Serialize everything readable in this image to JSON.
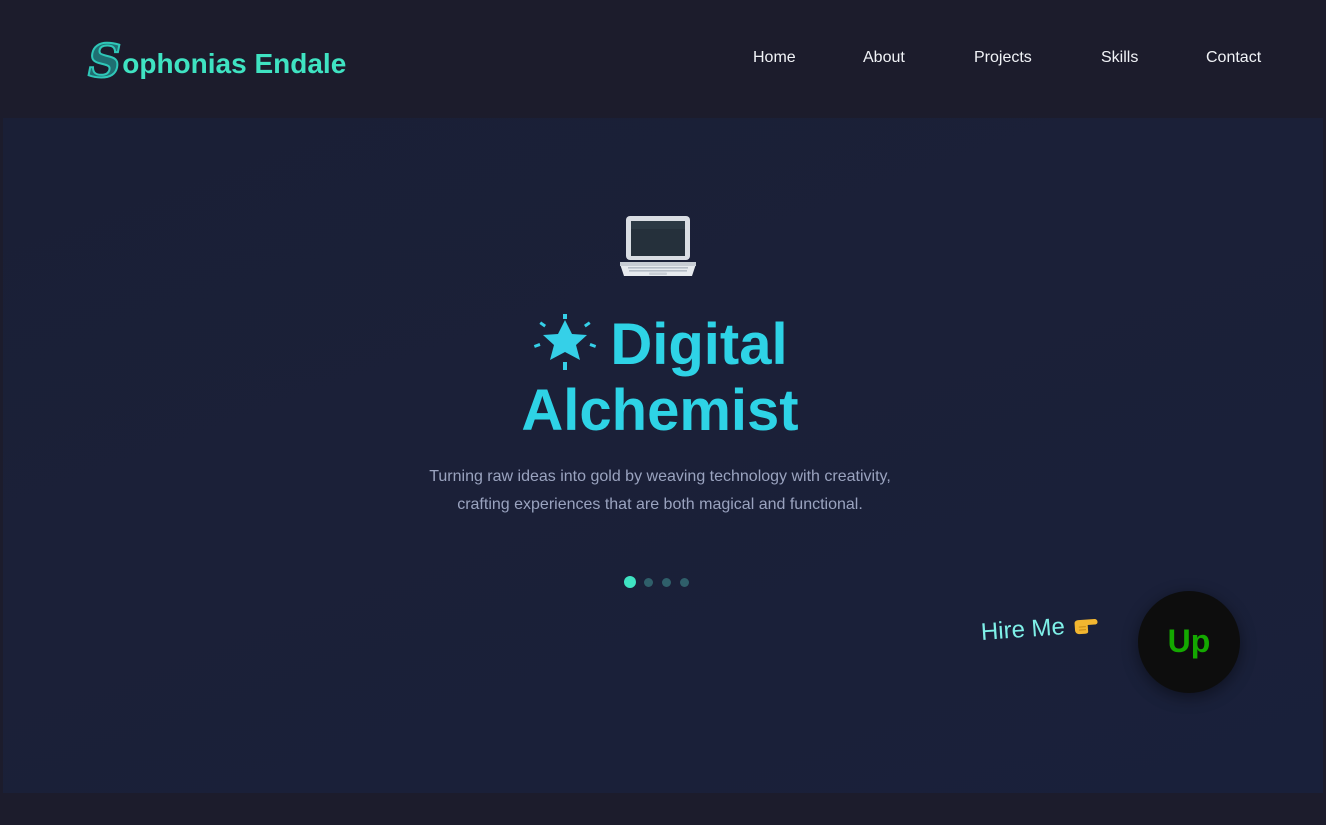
{
  "header": {
    "logo_initial": "S",
    "logo_rest": "ophonias Endale",
    "nav": [
      {
        "label": "Home"
      },
      {
        "label": "About"
      },
      {
        "label": "Projects"
      },
      {
        "label": "Skills"
      },
      {
        "label": "Contact"
      }
    ]
  },
  "hero": {
    "top_icon": "laptop-icon",
    "title_icon": "sparkle-star-icon",
    "title_line1": "Digital",
    "title_line2": "Alchemist",
    "subtitle_line1": "Turning raw ideas into gold by weaving technology with creativity,",
    "subtitle_line2": "crafting experiences that are both magical and functional.",
    "carousel": {
      "count": 4,
      "active_index": 0
    }
  },
  "hire": {
    "label": "Hire Me",
    "pointer_icon": "pointing-hand-icon",
    "button_icon": "upwork-logo-icon",
    "button_text": "Up"
  },
  "colors": {
    "background": "#1c1c2c",
    "hero_background": "#1b2038",
    "accent": "#2ed3e6",
    "logo": "#3fe3c2",
    "upwork_green": "#14a800"
  }
}
